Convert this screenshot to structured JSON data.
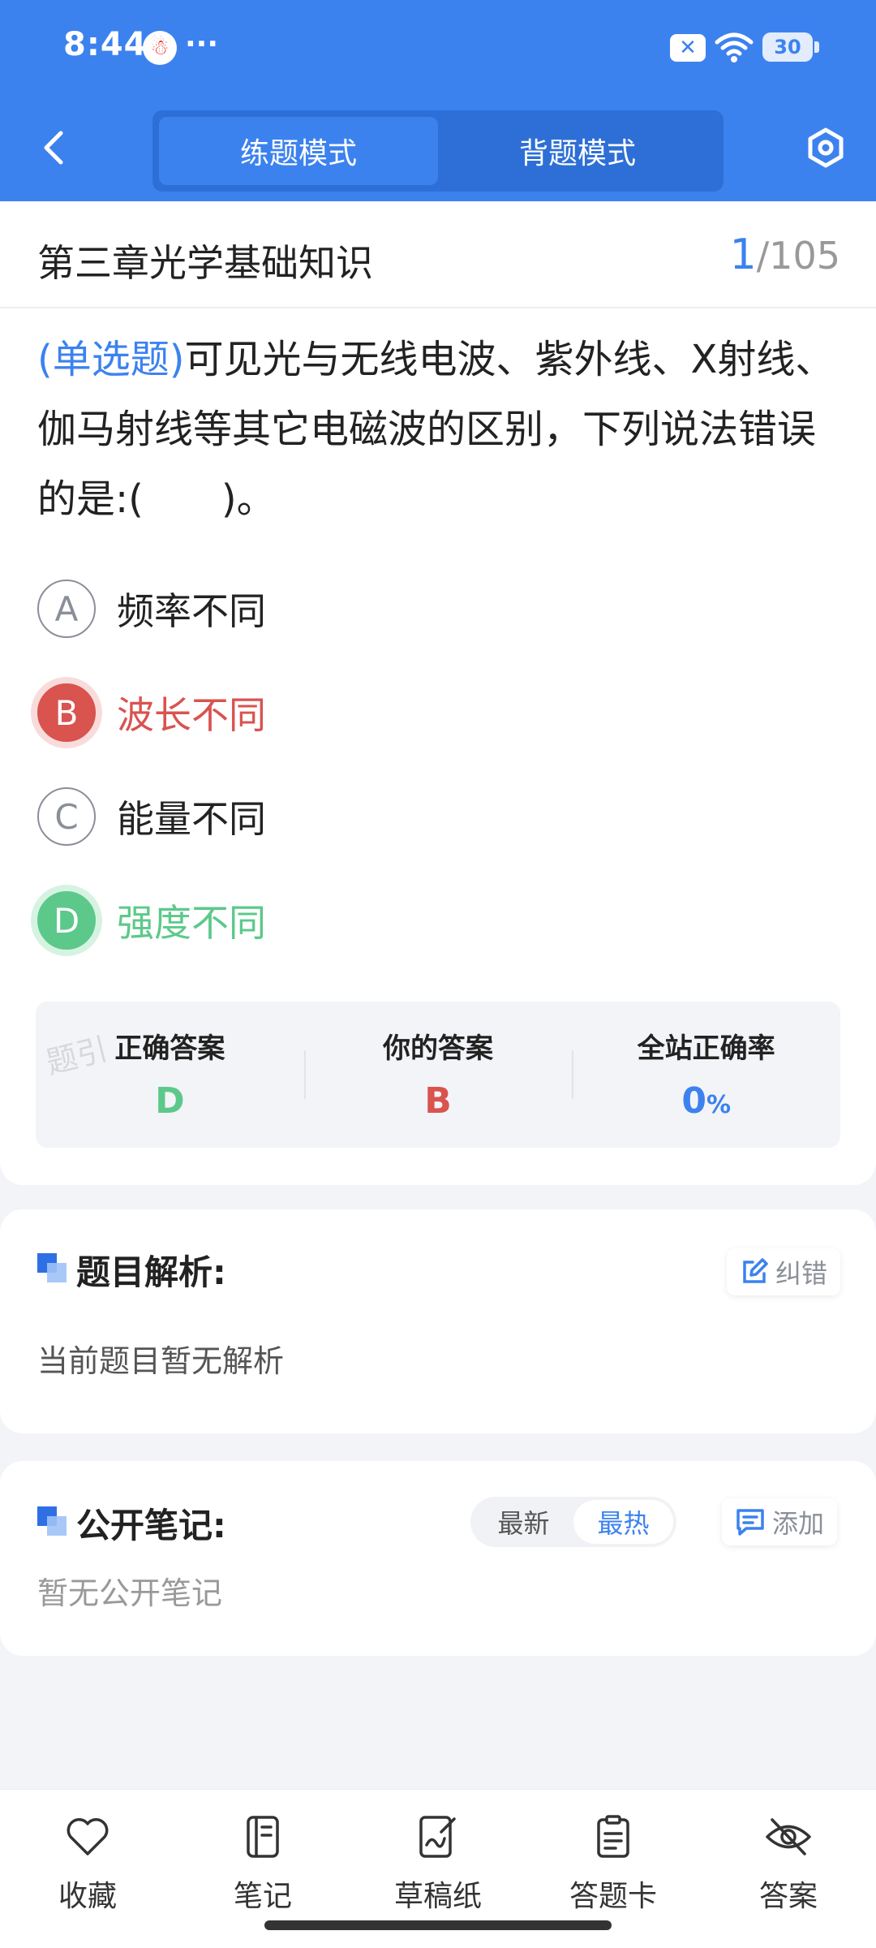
{
  "status_bar": {
    "time": "8:44",
    "more": "···",
    "battery": "30"
  },
  "nav": {
    "modes": [
      "练题模式",
      "背题模式"
    ],
    "active_mode": "练题模式"
  },
  "chapter": {
    "title": "第三章光学基础知识",
    "current": "1",
    "total": "/105"
  },
  "question": {
    "type_label": "(单选题)",
    "text": "可见光与无线电波、紫外线、X射线、伽马射线等其它电磁波的区别，下列说法错误的是:(　　)。",
    "options": [
      {
        "key": "A",
        "text": "频率不同",
        "state": "normal"
      },
      {
        "key": "B",
        "text": "波长不同",
        "state": "wrong"
      },
      {
        "key": "C",
        "text": "能量不同",
        "state": "normal"
      },
      {
        "key": "D",
        "text": "强度不同",
        "state": "correct"
      }
    ]
  },
  "answer_summary": {
    "correct_label": "正确答案",
    "correct_value": "D",
    "mine_label": "你的答案",
    "mine_value": "B",
    "rate_label": "全站正确率",
    "rate_value": "0",
    "rate_unit": "%",
    "watermark": "题引"
  },
  "analysis": {
    "title": "题目解析:",
    "report_label": "纠错",
    "text": "当前题目暂无解析"
  },
  "notes": {
    "title": "公开笔记:",
    "sort_options": [
      "最新",
      "最热"
    ],
    "active_sort": "最热",
    "add_label": "添加",
    "empty_text": "暂无公开笔记"
  },
  "toolbar": {
    "items": [
      {
        "label": "收藏",
        "icon": "heart-icon"
      },
      {
        "label": "笔记",
        "icon": "notebook-icon"
      },
      {
        "label": "草稿纸",
        "icon": "draft-icon"
      },
      {
        "label": "答题卡",
        "icon": "clipboard-icon"
      },
      {
        "label": "答案",
        "icon": "eye-off-icon"
      }
    ]
  },
  "colors": {
    "primary": "#3c82ef",
    "wrong": "#d9534f",
    "correct": "#5cc98a"
  }
}
